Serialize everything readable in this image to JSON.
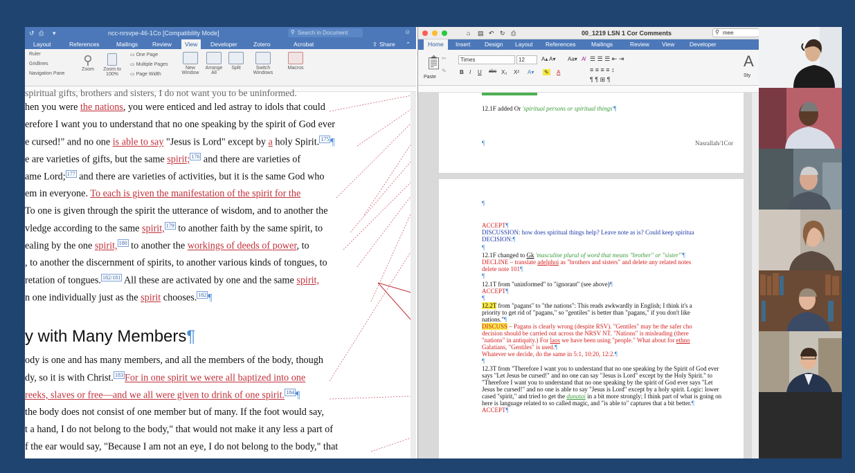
{
  "left_window": {
    "title": "ncc-nrsvpe-46-1Co [Compatibility Mode]",
    "search_placeholder": "Search in Document",
    "tabs": [
      "Layout",
      "References",
      "Mailings",
      "Review",
      "View",
      "Developer",
      "Zotero",
      "Acrobat"
    ],
    "selected_tab": "View",
    "share_label": "Share",
    "ribbon": {
      "ruler": "Ruler",
      "gridlines": "Gridlines",
      "navigation_pane": "Navigation Pane",
      "zoom": "Zoom",
      "zoom_100": "Zoom to 100%",
      "one_page": "One Page",
      "multiple_pages": "Multiple Pages",
      "page_width": "Page Width",
      "new_window": "New Window",
      "arrange_all": "Arrange All",
      "split": "Split",
      "switch_windows": "Switch Windows",
      "macros": "Macros"
    },
    "doc": {
      "line1": "spiritual gifts, brothers and sisters, I do not want you to be uninformed.",
      "line2a": "hen you were ",
      "line2b": "the nations",
      "line2c": ", you were enticed and led astray to idols that could",
      "line3": "erefore I want you to understand that no one speaking by the spirit of God ever",
      "line4a": "e cursed!\" and no one ",
      "line4b": "is able to say",
      "line4c": " \"Jesus is Lord\" except by ",
      "line4d": "a",
      "line4e": " holy Spirit.",
      "line4s": "175",
      "line5a": "e are varieties of gifts, but the same ",
      "line5b": "spirit;",
      "line5s": "176",
      "line5c": " and there are varieties of",
      "line6a": "ame Lord;",
      "line6s": "177",
      "line6b": " and there are varieties of activities, but it is the same God who",
      "line7a": "em in everyone. ",
      "line7b": "To each is given the manifestation of the spirit for the",
      "line8": "To one is given through the spirit the utterance of wisdom, and to another the",
      "line9a": "vledge according to the same ",
      "line9b": "spirit,",
      "line9s": "179",
      "line9c": " to another faith by the same spirit, to",
      "line10a": "ealing by the one ",
      "line10b": "spirit,",
      "line10s": "180",
      "line10c": " to another the ",
      "line10d": "workings of deeds of power",
      "line10e": ", to",
      "line11": ", to another the discernment of spirits, to another various kinds of tongues, to",
      "line12a": "retation of tongues.",
      "line12s": "182/181",
      "line12b": " All these are activated by one and the same ",
      "line12c": "spirit,",
      "line13a": "n one individually just as the ",
      "line13b": "spirit",
      "line13c": " chooses.",
      "line13s": "182",
      "heading": "y with Many Members",
      "line14": "ody is one and has many members, and all the members of the body, though",
      "line15a": "dy, so it is with Christ.",
      "line15s": "183",
      "line15b": "For in one spirit we were all baptized into one",
      "line16a": "reeks, slaves or free—and we all were given to drink of one spirit.",
      "line16s": "184",
      "line17": "the body does not consist of one member but of many. If the foot would say,",
      "line18": "t a hand, I do not belong to the body,\" that would not make it any less a part of",
      "line19": "f the ear would say, \"Because I am not an eye, I do not belong to the body,\" that"
    }
  },
  "right_window": {
    "title": "00_1219 LSN 1 Cor Comments",
    "search_placeholder": "mee",
    "tabs": [
      "Home",
      "Insert",
      "Design",
      "Layout",
      "References",
      "Mailings",
      "Review",
      "View",
      "Developer"
    ],
    "selected_tab": "Home",
    "font_name": "Times",
    "font_size": "12",
    "paste_label": "Paste",
    "styles_label": "Sty",
    "doc": {
      "p1a": "12.1F added Or ",
      "p1b": "'spiritual persons or spiritual things'",
      "p1_footer": "Nasrallah/1Cor",
      "accept1": "ACCEPT",
      "discussion": "DISCUSSION: how does spiritual things help? Leave note as is? Could keep spiritua",
      "decision": "DECISION:",
      "p2a": "12.1F changed to ",
      "p2b": "Gk",
      "p2c": " 'masculine plural of word that means \"brother\" or \"sister\"'",
      "decline_a": "DECLINE – translate ",
      "decline_b": "adelphoi",
      "decline_c": " as \"brothers and sisters\" and delete any related notes",
      "delete_note": "delete note 101",
      "p3": "12.1T from \"uninformed\" to \"ignorant\" (see above)",
      "accept2": "ACCEPT",
      "p4a": "12.2T",
      "p4b": " from \"pagans\" to \"the nations\": This reads awkwardly in English; I think it's a",
      "p4c": "priority to get rid of \"pagans,\" so \"gentiles\" is better than \"pagans,\" if you don't like",
      "p4d": "nations.\"",
      "discuss_a": "DISCUSS",
      "discuss_b": " – Pagans is clearly wrong (despite RSV). \"Gentiles\" may be the safer cho",
      "discuss_c": "decision should be carried out across the NRSV NT. \"Nations\" is misleading (there",
      "discuss_d": "\"nations\" in antiquity.) For ",
      "discuss_e": "laos",
      "discuss_f": " we have been using \"people.\" What about for ",
      "discuss_g": "ethno",
      "discuss_h": "Galatians, \"Gentiles\" is used.",
      "whatever": "Whatever we decide, do the same in 5:1, 10:20, 12:2.",
      "p5a": "12.3T from \"Therefore I want you to understand that no one speaking by the Spirit of God ever",
      "p5b": "says \"Let Jesus be cursed!\" and no one can say \"Jesus is Lord\" except by the Holy Spirit.\" to",
      "p5c": "\"Therefore I want you to understand that no one speaking by the spirit of God ever says \"Let",
      "p5d": "Jesus be cursed!\" and no one is able to say \"Jesus is Lord\" except by a holy spirit. Logic: lower",
      "p5e": "cased \"spirit,\" and tried to get the ",
      "p5f": "dunatai",
      "p5g": " in a bit more strongly; I think part of what is going on",
      "p5h": "here is language related to so called magic, and \"is able to\" captures that a bit better.",
      "accept3": "ACCEPT"
    }
  },
  "video_tiles": [
    {
      "icon": "person-headset"
    },
    {
      "icon": "person"
    },
    {
      "icon": "person"
    },
    {
      "icon": "person"
    },
    {
      "icon": "person"
    },
    {
      "icon": "person"
    }
  ],
  "colors": {
    "frame": "#1f4470",
    "word_blue": "#4c78b9",
    "track_red": "#c0303a"
  }
}
